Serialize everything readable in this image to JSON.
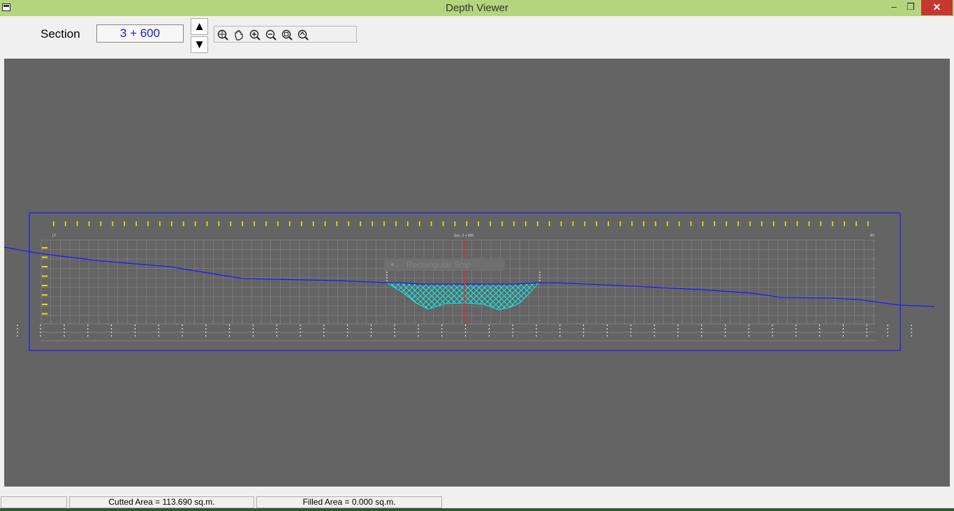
{
  "window": {
    "title": "Depth Viewer",
    "minimize": "–",
    "maximize": "❐",
    "close": "✕"
  },
  "header": {
    "section_label": "Section",
    "section_value": "3 + 600",
    "up_arrow": "▲",
    "down_arrow": "▼"
  },
  "toolbar": {
    "tools": [
      "zoom-extents-icon",
      "pan-hand-icon",
      "zoom-in-icon",
      "zoom-out-icon",
      "zoom-window-icon",
      "zoom-previous-icon"
    ]
  },
  "drawing": {
    "left_label": "LT",
    "right_label": "RT",
    "center_label": "Sec. 3 + 600",
    "colors": {
      "background": "#646464",
      "frame": "#0000ff",
      "ground_line": "#0000ff",
      "cut_fill": "#00ffff",
      "centerline": "#ff0000",
      "grid": "#8a8a8a",
      "elevation_labels": "#ffff00"
    }
  },
  "overlay": {
    "snip_label": "Rectangular Snip"
  },
  "status_bar": {
    "cell1": "",
    "cut_area": "Cutted Area = 113.690 sq.m.",
    "fill_area": "Filled Area = 0.000 sq.m."
  }
}
